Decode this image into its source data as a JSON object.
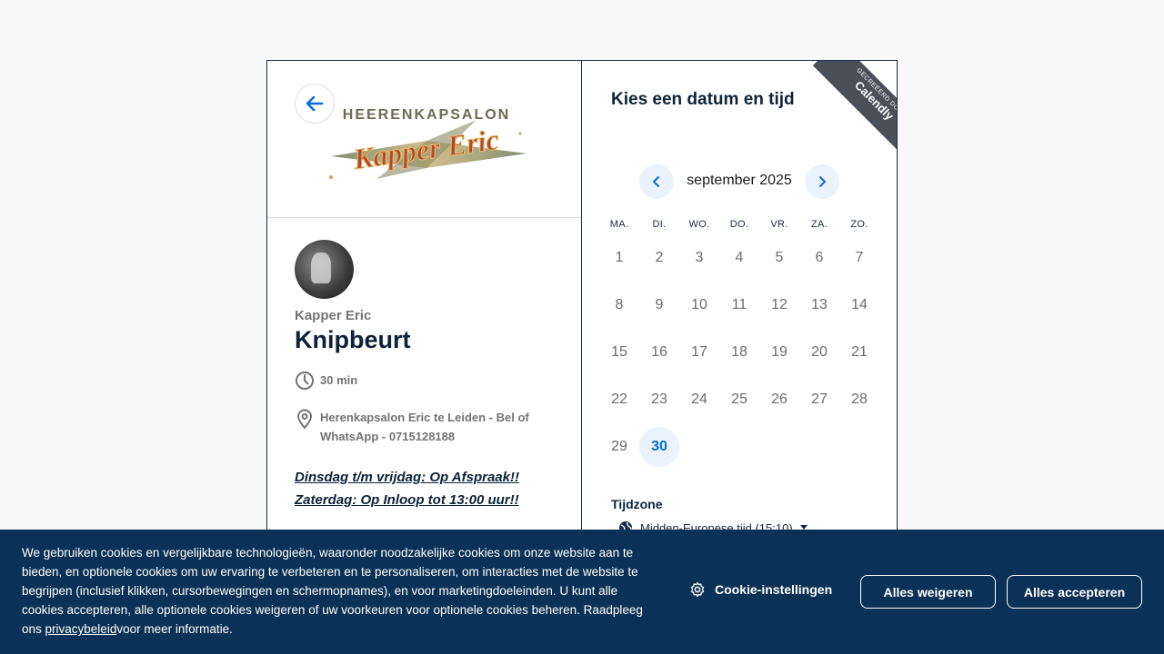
{
  "event": {
    "host": "Kapper Eric",
    "title": "Knipbeurt",
    "duration": "30 min",
    "location": "Herenkapsalon Eric te Leiden - Bel of WhatsApp - 0715128188",
    "note_line1": "Dinsdag t/m vrijdag: Op Afspraak!!",
    "note_line2": "Zaterdag: Op Inloop tot 13:00 uur!!",
    "logo_top_text": "HEERENKAPSALON",
    "logo_script_text": "Kapper Eric"
  },
  "calendar": {
    "heading": "Kies een datum en tijd",
    "month": "september 2025",
    "weekdays": [
      "MA.",
      "DI.",
      "WO.",
      "DO.",
      "VR.",
      "ZA.",
      "ZO."
    ],
    "days": [
      "1",
      "2",
      "3",
      "4",
      "5",
      "6",
      "7",
      "8",
      "9",
      "10",
      "11",
      "12",
      "13",
      "14",
      "15",
      "16",
      "17",
      "18",
      "19",
      "20",
      "21",
      "22",
      "23",
      "24",
      "25",
      "26",
      "27",
      "28",
      "29",
      "30"
    ],
    "selected": "30",
    "timezone_label": "Tijdzone",
    "timezone_value": "Midden-Europese tijd (15:10)"
  },
  "ribbon": {
    "small": "GECREËERD DOOR",
    "big": "Calendly"
  },
  "cookie": {
    "text": "We gebruiken cookies en vergelijkbare technologieën, waaronder noodzakelijke cookies om onze website aan te bieden, en optionele cookies om uw ervaring te verbeteren en te personaliseren, om interacties met de website te begrijpen (inclusief klikken, cursorbewegingen en schermopnames), en voor marketingdoeleinden. U kunt alle cookies accepteren, alle optionele cookies weigeren of uw voorkeuren voor optionele cookies beheren. Raadpleeg ons ",
    "link": "privacybeleid",
    "text_after": "voor meer informatie.",
    "settings_label": "Cookie-instellingen",
    "reject_label": "Alles weigeren",
    "accept_label": "Alles accepteren"
  },
  "colors": {
    "accent": "#0b6be0",
    "navy": "#0b2239",
    "cookie_bg": "#0b3256",
    "selected_bg": "#e9f2fd"
  }
}
